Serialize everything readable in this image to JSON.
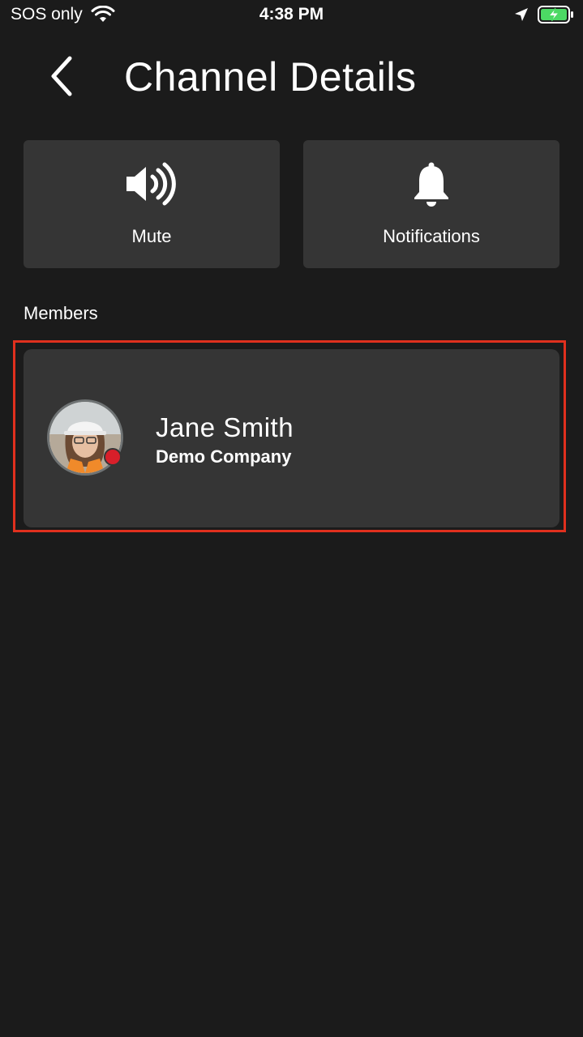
{
  "status_bar": {
    "carrier": "SOS only",
    "time": "4:38 PM",
    "icons": [
      "wifi-icon",
      "location-arrow-icon",
      "battery-charging-icon"
    ]
  },
  "header": {
    "title": "Channel Details",
    "back_icon": "chevron-left-icon"
  },
  "actions": [
    {
      "label": "Mute",
      "icon": "speaker-volume-icon"
    },
    {
      "label": "Notifications",
      "icon": "bell-icon"
    }
  ],
  "members": {
    "label": "Members",
    "items": [
      {
        "name": "Jane Smith",
        "company": "Demo Company",
        "avatar": "user-avatar-photo",
        "status": "presence-red",
        "status_color": "#d81f2a"
      }
    ]
  },
  "colors": {
    "background": "#1b1b1b",
    "tile": "#353535",
    "highlight": "#e0301e",
    "battery": "#4cd964"
  }
}
